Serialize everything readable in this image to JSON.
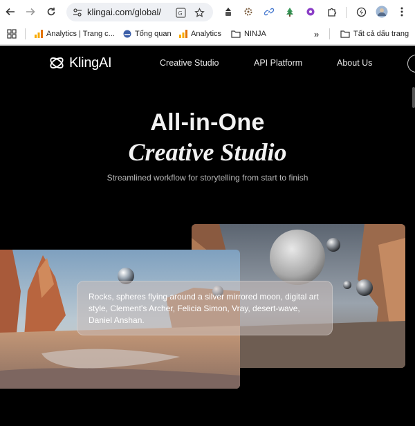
{
  "browser": {
    "url": "klingai.com/global/",
    "bookmarks": [
      {
        "label": "Analytics | Trang c...",
        "icon": "analytics-icon"
      },
      {
        "label": "Tổng quan",
        "icon": "overview-icon"
      },
      {
        "label": "Analytics",
        "icon": "analytics-icon"
      },
      {
        "label": "NINJA",
        "icon": "folder-icon"
      }
    ],
    "overflow": "»",
    "all_bookmarks": "Tất cả dấu trang"
  },
  "site": {
    "brand": "KlingAI",
    "nav": [
      "Creative Studio",
      "API Platform",
      "About Us"
    ]
  },
  "hero": {
    "line1": "All-in-One",
    "line2": "Creative Studio",
    "subtitle": "Streamlined workflow for storytelling from start to finish"
  },
  "showcase": {
    "prompt": "Rocks, spheres flying around a silver mirrored moon, digital art style, Clement's Archer, Felicia Simon, Vray, desert-wave, Daniel Anshan."
  },
  "colors": {
    "page_bg": "#000000",
    "text": "#f2f2f2",
    "muted": "#b8b8b8"
  }
}
